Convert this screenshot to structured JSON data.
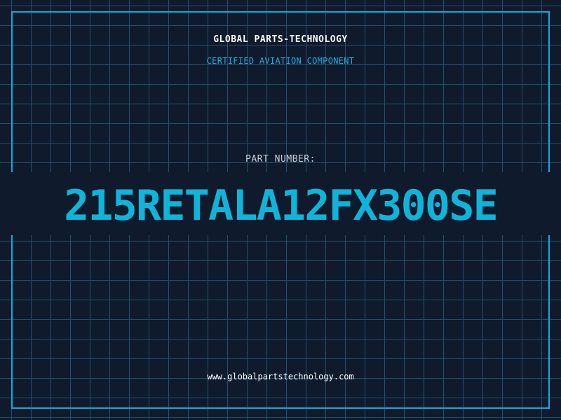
{
  "header": {
    "company": "GLOBAL PARTS-TECHNOLOGY",
    "subtitle": "CERTIFIED AVIATION COMPONENT"
  },
  "part": {
    "label": "PART NUMBER:",
    "number": "215RETALA12FX300SE"
  },
  "footer": {
    "url": "www.globalpartstechnology.com"
  },
  "colors": {
    "background": "#0f1a2d",
    "grid": "#24506a",
    "frame": "#1aa6d6",
    "accent": "#0fb5d9",
    "heading": "#ffffff"
  }
}
